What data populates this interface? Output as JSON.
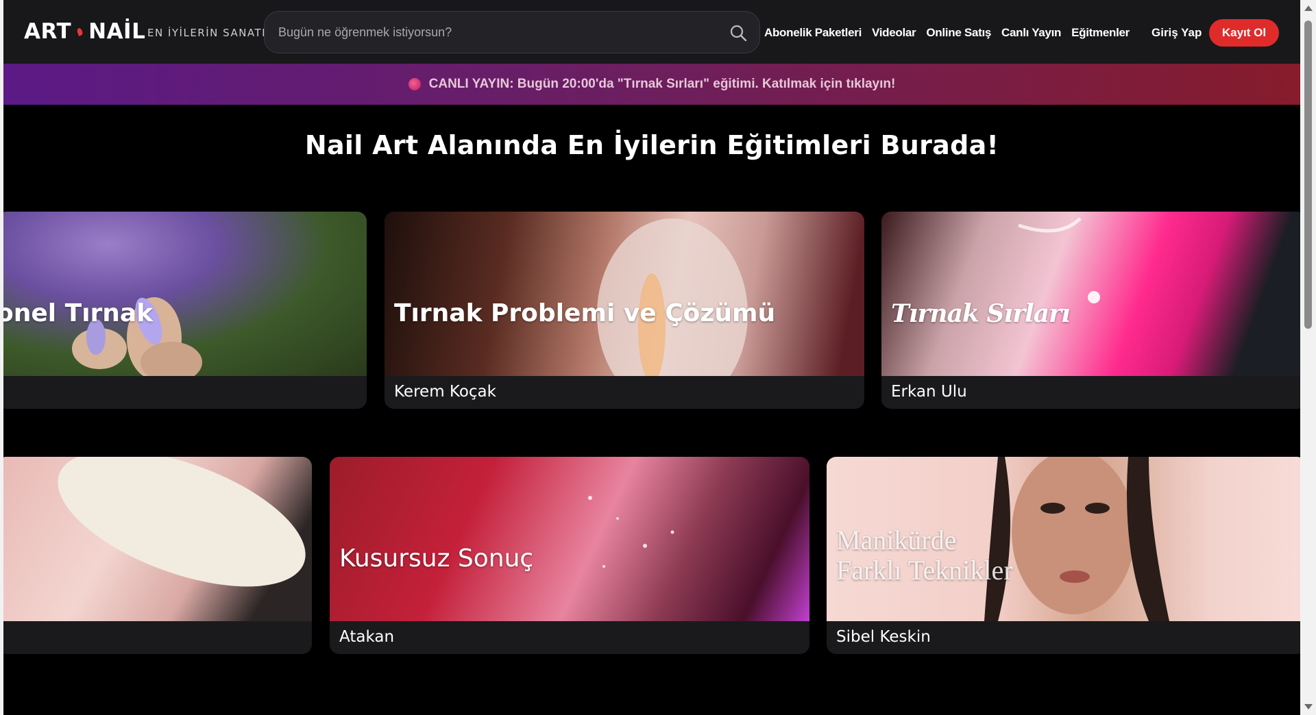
{
  "header": {
    "logo_left": "ART",
    "logo_right": "NAİL",
    "tagline": "EN İYİLERİN SANATI",
    "search_placeholder": "Bugün ne öğrenmek istiyorsun?",
    "search_icon": "search-icon",
    "nav": [
      {
        "label": "Abonelik Paketleri"
      },
      {
        "label": "Videolar"
      },
      {
        "label": "Online Satış"
      },
      {
        "label": "Canlı Yayın"
      },
      {
        "label": "Eğitmenler"
      }
    ],
    "login_label": "Giriş Yap",
    "signup_label": "Kayıt Ol",
    "accent_color": "#e02b2b"
  },
  "banner": {
    "text": "CANLI YAYIN: Bugün 20:00'da \"Tırnak Sırları\" eğitimi. Katılmak için tıklayın!"
  },
  "main": {
    "heading": "Nail Art Alanında En İyilerin Eğitimleri Burada!",
    "row1": [
      {
        "title": "onel Tırnak",
        "author": ""
      },
      {
        "title": "Tırnak Problemi ve Çözümü",
        "author": "Kerem Koçak"
      },
      {
        "title": "Tırnak Sırları",
        "author": "Erkan Ulu"
      }
    ],
    "row2": [
      {
        "title": "",
        "author": ""
      },
      {
        "title": "Kusursuz Sonuç",
        "author": "Atakan"
      },
      {
        "title_line1": "Manikürde",
        "title_line2": "Farklı Teknikler",
        "author": "Sibel Keskin"
      }
    ]
  }
}
